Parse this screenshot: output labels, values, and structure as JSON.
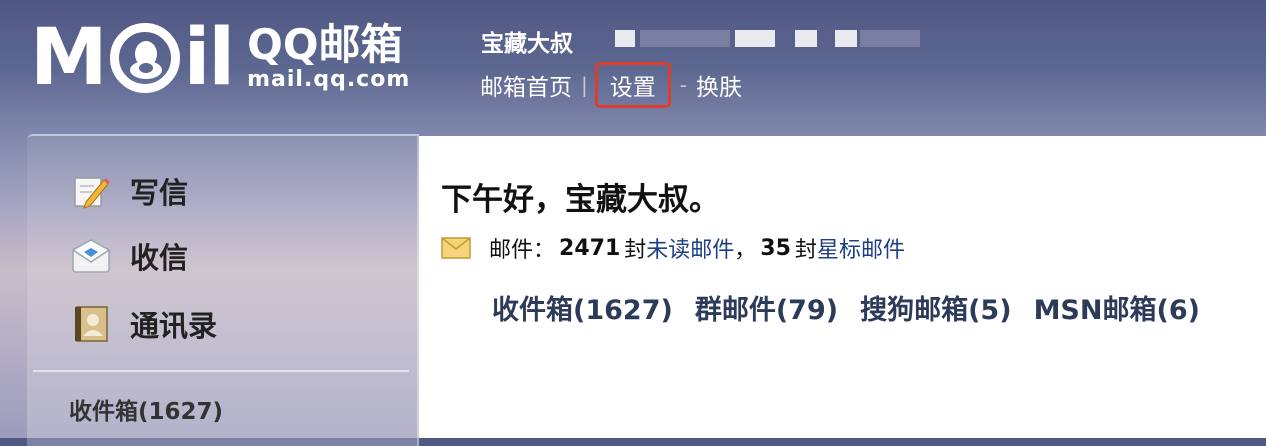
{
  "logo": {
    "brand_text": "MOil",
    "product": "QQ邮箱",
    "domain": "mail.qq.com"
  },
  "header": {
    "user_name": "宝藏大叔",
    "links": [
      {
        "label": "邮箱首页"
      },
      {
        "label": "设置"
      },
      {
        "label": "换肤"
      }
    ],
    "highlighted_link": "设置",
    "highlight_color": "#e03c2c"
  },
  "sidebar": {
    "items": [
      {
        "label": "写信",
        "icon": "compose-icon"
      },
      {
        "label": "收信",
        "icon": "inbox-icon"
      },
      {
        "label": "通讯录",
        "icon": "contacts-icon"
      }
    ],
    "folder": "收件箱(1627)"
  },
  "main": {
    "greeting": "下午好，宝藏大叔。",
    "stats": {
      "prefix": "邮件：",
      "unread_count": "2471",
      "unit1": "封",
      "unread_label": "未读邮件",
      "comma": "，",
      "star_count": "35",
      "unit2": "封",
      "star_label": "星标邮件"
    },
    "folders": [
      {
        "label": "收件箱(1627)"
      },
      {
        "label": "群邮件(79)"
      },
      {
        "label": "搜狗邮箱(5)"
      },
      {
        "label": "MSN邮箱(6)"
      }
    ]
  }
}
